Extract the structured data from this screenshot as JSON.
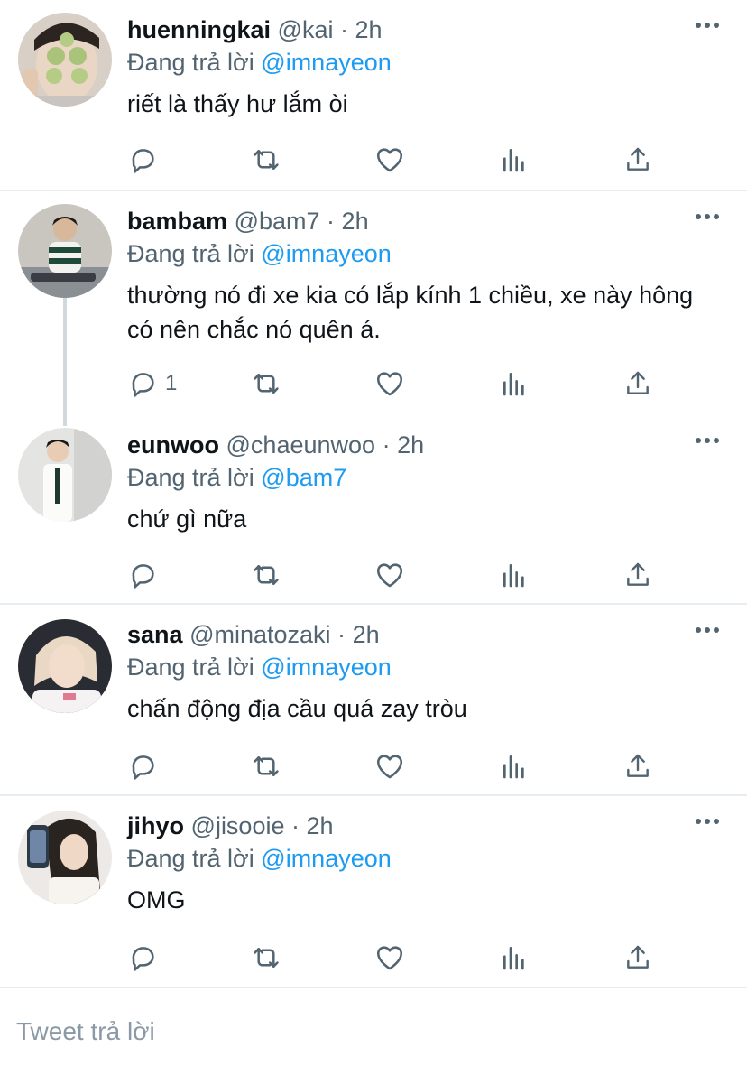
{
  "tweets": [
    {
      "name": "huenningkai",
      "handle": "@kai",
      "time": "2h",
      "replying_prefix": "Đang trả lời",
      "replying_to": "@imnayeon",
      "text": "riết là thấy hư lắm òi",
      "reply_count": ""
    },
    {
      "name": "bambam",
      "handle": "@bam7",
      "time": "2h",
      "replying_prefix": "Đang trả lời",
      "replying_to": "@imnayeon",
      "text": "thường nó đi xe kia có lắp kính 1 chiều, xe này hông có nên chắc nó quên á.",
      "reply_count": "1"
    },
    {
      "name": "eunwoo",
      "handle": "@chaeunwoo",
      "time": "2h",
      "replying_prefix": "Đang trả lời",
      "replying_to": "@bam7",
      "text": "chứ gì nữa",
      "reply_count": ""
    },
    {
      "name": "sana",
      "handle": "@minatozaki",
      "time": "2h",
      "replying_prefix": "Đang trả lời",
      "replying_to": "@imnayeon",
      "text": "chấn động địa cầu quá zay tròu",
      "reply_count": ""
    },
    {
      "name": "jihyo",
      "handle": "@jisooie",
      "time": "2h",
      "replying_prefix": "Đang trả lời",
      "replying_to": "@imnayeon",
      "text": "OMG",
      "reply_count": ""
    }
  ],
  "separator": "·",
  "reply_box": {
    "placeholder": "Tweet trả lời"
  },
  "icons": [
    "reply-icon",
    "retweet-icon",
    "like-icon",
    "analytics-icon",
    "share-icon",
    "more-icon"
  ],
  "colors": {
    "link": "#1d9bf0",
    "secondary_text": "#536471",
    "icon": "#536471",
    "divider": "#e6ecf0"
  }
}
